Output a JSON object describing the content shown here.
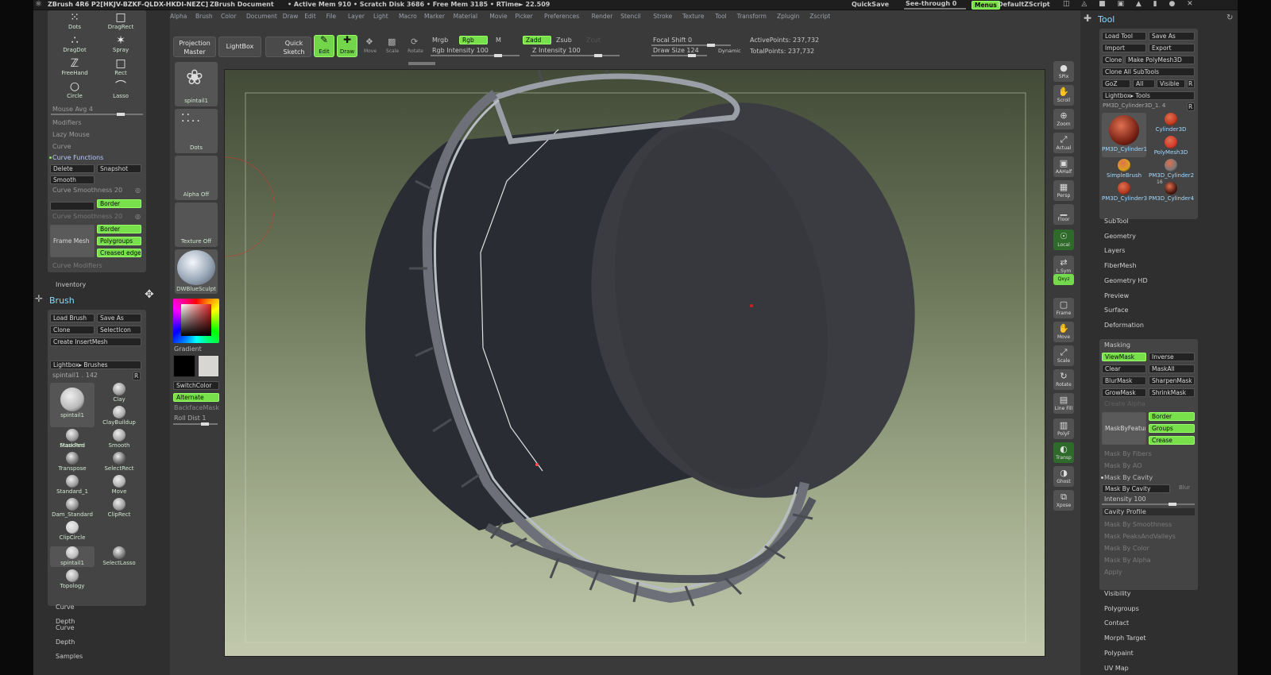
{
  "menubar": {
    "title": "ZBrush 4R6  P2[HKJV-BZKF-QLDX-HKDI-NEZC]",
    "doc": "ZBrush Document",
    "stats": "• Active Mem 910 • Scratch Disk 3686 • Free Mem 3185 • RTime► 22.509",
    "quicksave": "QuickSave",
    "see_through": "See-through  0",
    "menus": "Menus",
    "script": "DefaultZScript"
  },
  "menus": [
    "Alpha",
    "Brush",
    "Color",
    "Document",
    "Draw",
    "Edit",
    "File",
    "Layer",
    "Light",
    "Macro",
    "Marker",
    "Material",
    "Movie",
    "Picker",
    "Preferences",
    "Render",
    "Stencil",
    "Stroke",
    "Texture",
    "Tool",
    "Transform",
    "Zplugin",
    "Zscript"
  ],
  "top_toolbar": {
    "projection_master": "Projection\nMaster",
    "lightbox": "LightBox",
    "quick_sketch": "Quick\nSketch",
    "edit": "Edit",
    "draw": "Draw",
    "move": "Move",
    "scale": "Scale",
    "rotate": "Rotate",
    "mrgb": "Mrgb",
    "rgb": "Rgb",
    "m": "M",
    "zadd": "Zadd",
    "zsub": "Zsub",
    "zcut": "Zcut",
    "rgb_intensity": "Rgb Intensity 100",
    "z_intensity": "Z Intensity 100",
    "focal_shift": "Focal Shift 0",
    "draw_size": "Draw Size 124",
    "dynamic": "Dynamic",
    "active_points": "ActivePoints: 237,732",
    "total_points": "TotalPoints: 237,732"
  },
  "left_stroke": {
    "tiles": [
      "Dots",
      "DragRect",
      "DragDot",
      "Spray",
      "FreeHand",
      "Rect",
      "Circle",
      "Lasso"
    ],
    "mouse_avg": "Mouse Avg 4",
    "modifiers": "Modifiers",
    "lazy_mouse": "Lazy Mouse",
    "curve": "Curve",
    "curve_functions": "Curve Functions",
    "delete": "Delete",
    "snapshot": "Snapshot",
    "smooth": "Smooth",
    "curve_smoothness": "Curve Smoothness 20",
    "border": "Border",
    "curve_smoothness2": "Curve Smoothness 20",
    "frame_mesh": "Frame Mesh",
    "border2": "Border",
    "polygroups": "Polygroups",
    "creased_edges": "Creased edges",
    "curve_modifiers": "Curve Modifiers",
    "inventory": "Inventory"
  },
  "brush_palette": {
    "title": "Brush",
    "load_brush": "Load Brush",
    "save_as": "Save As",
    "clone": "Clone",
    "select_icon": "SelectIcon",
    "create_insertmesh": "Create InsertMesh",
    "lightbox_brushes": "Lightbox▸ Brushes",
    "current": "spintail1 . 142",
    "r": "R",
    "brushes": [
      "spintail1",
      "Clay",
      "ClayBuildup",
      "MaskPen",
      "Standard",
      "Smooth",
      "Transpose",
      "SelectRect",
      "Standard_1",
      "Move",
      "Dam_Standard",
      "ClipRect",
      "ClipCircle",
      "spintail1",
      "SelectLasso",
      "Topology"
    ]
  },
  "left_bottom": [
    "Curve",
    "Depth Curve",
    "Depth",
    "Samples"
  ],
  "shelf": {
    "brush": "spintail1",
    "stroke": "Dots",
    "alpha": "Alpha Off",
    "texture": "Texture Off",
    "material": "DWBlueSculpt",
    "gradient": "Gradient",
    "switch_color": "SwitchColor",
    "alternate": "Alternate",
    "backface": "BackfaceMask",
    "roll_dist": "Roll Dist 1"
  },
  "right_shelf": [
    "SPix",
    "Scroll",
    "Zoom",
    "Actual",
    "AAHalf",
    "Persp",
    "Floor",
    "Local",
    "L.Sym",
    "Qxyz",
    "Frame",
    "Move",
    "Scale",
    "Rotate",
    "Line Fill",
    "PolyF",
    "Transp",
    "Ghost",
    "Xpose"
  ],
  "tool_palette": {
    "title": "Tool",
    "load_tool": "Load Tool",
    "save_as": "Save As",
    "import": "Import",
    "export": "Export",
    "clone": "Clone",
    "make_polymesh": "Make PolyMesh3D",
    "clone_all": "Clone All SubTools",
    "goz": "GoZ",
    "all": "All",
    "visible": "Visible",
    "r": "R",
    "lightbox_tools": "Lightbox▸ Tools",
    "current": "PM3D_Cylinder3D_1. 4",
    "tools": [
      "PM3D_Cylinder1",
      "Cylinder3D",
      "PolyMesh3D",
      "SimpleBrush",
      "PM3D_Cylinder2",
      "PM3D_Cylinder3",
      "PM3D_Cylinder4"
    ],
    "tools_num": "16",
    "sections": [
      "SubTool",
      "Geometry",
      "Layers",
      "FiberMesh",
      "Geometry HD",
      "Preview",
      "Surface",
      "Deformation"
    ],
    "masking": {
      "title": "Masking",
      "viewmask": "ViewMask",
      "inverse": "Inverse",
      "clear": "Clear",
      "maskall": "MaskAll",
      "blurmask": "BlurMask",
      "sharpenmask": "SharpenMask",
      "growmask": "GrowMask",
      "shrinkmask": "ShrinkMask",
      "create_alpha": "Create Alpha",
      "maskbyfeature": "MaskByFeature",
      "border": "Border",
      "groups": "Groups",
      "crease": "Crease",
      "mask_by_fibers": "Mask By Fibers",
      "mask_by_ao": "Mask By AO",
      "mask_by_cavity_hdr": "Mask By Cavity",
      "mask_by_cavity": "Mask By Cavity",
      "blur": "Blur",
      "intensity": "Intensity 100",
      "cavity_profile": "Cavity Profile",
      "mask_by_smoothness": "Mask By Smoothness",
      "mask_peaks": "Mask PeaksAndValleys",
      "mask_by_color": "Mask By Color",
      "mask_by_alpha": "Mask By Alpha",
      "apply": "Apply"
    },
    "sections2": [
      "Visibility",
      "Polygroups",
      "Contact",
      "Morph Target",
      "Polypaint",
      "UV Map"
    ]
  }
}
